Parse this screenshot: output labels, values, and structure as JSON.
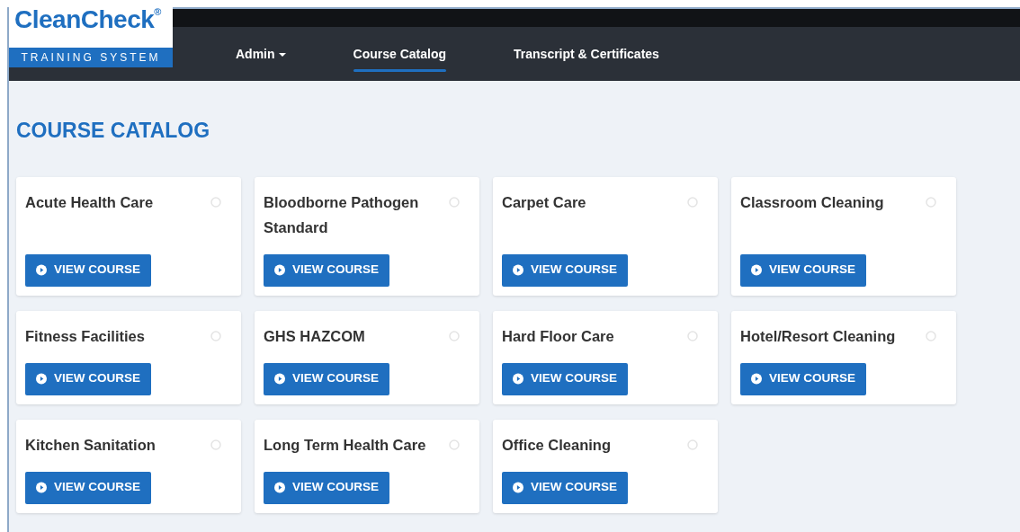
{
  "logo": {
    "name": "CleanCheck",
    "registered": "®",
    "tagline": "TRAINING SYSTEM"
  },
  "nav": [
    {
      "label": "Admin",
      "dropdown": true,
      "selected": false
    },
    {
      "label": "Course Catalog",
      "dropdown": false,
      "selected": true
    },
    {
      "label": "Transcript & Certificates",
      "dropdown": false,
      "selected": false
    }
  ],
  "heading": "COURSE CATALOG",
  "courses": [
    {
      "title": "Acute Health Care",
      "button": "VIEW COURSE"
    },
    {
      "title": "Bloodborne Pathogen Standard",
      "button": "VIEW COURSE"
    },
    {
      "title": "Carpet Care",
      "button": "VIEW COURSE"
    },
    {
      "title": "Classroom Cleaning",
      "button": "VIEW COURSE"
    },
    {
      "title": "Fitness Facilities",
      "button": "VIEW COURSE"
    },
    {
      "title": "GHS HAZCOM",
      "button": "VIEW COURSE"
    },
    {
      "title": "Hard Floor Care",
      "button": "VIEW COURSE"
    },
    {
      "title": "Hotel/Resort Cleaning",
      "button": "VIEW COURSE"
    },
    {
      "title": "Kitchen Sanitation",
      "button": "VIEW COURSE"
    },
    {
      "title": "Long Term Health Care",
      "button": "VIEW COURSE"
    },
    {
      "title": "Office Cleaning",
      "button": "VIEW COURSE"
    }
  ]
}
